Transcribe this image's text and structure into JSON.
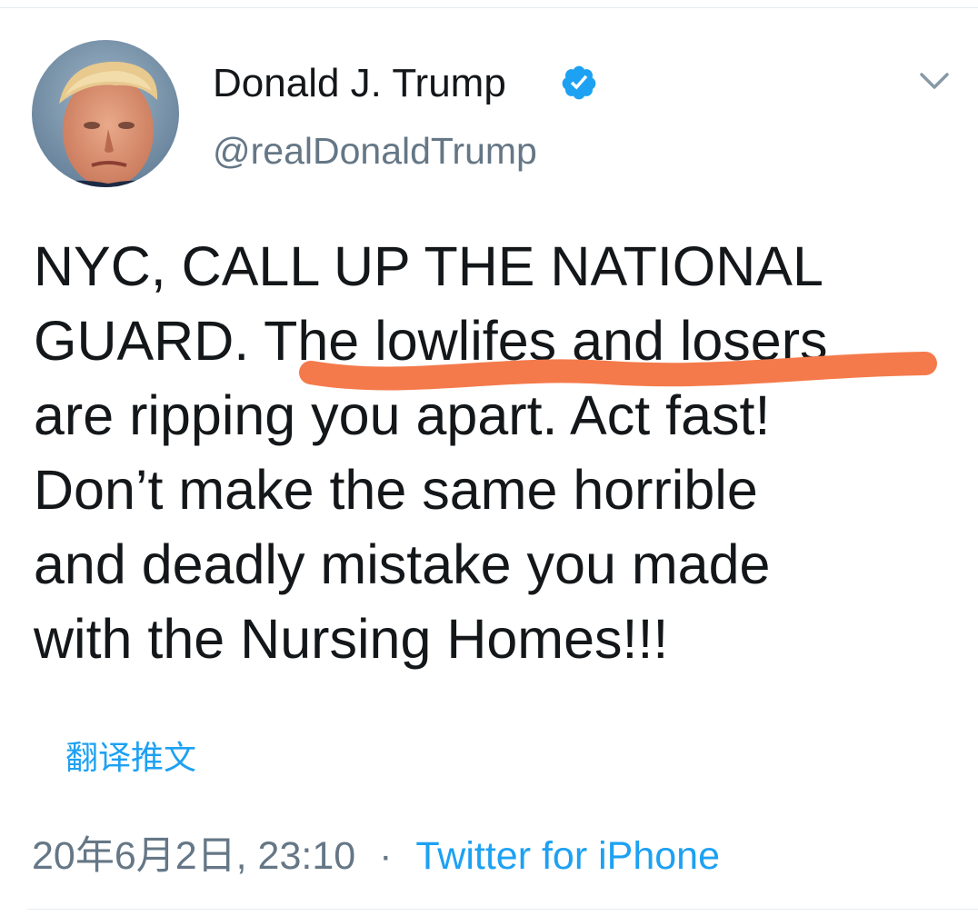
{
  "author": {
    "display_name": "Donald J. Trump",
    "handle": "@realDonaldTrump",
    "verified": true
  },
  "icons": {
    "verified": "verified-badge-icon",
    "more": "chevron-down-icon"
  },
  "tweet": {
    "text": "NYC, CALL UP THE NATIONAL\nGUARD. The lowlifes and losers\nare ripping you apart. Act fast!\nDon’t make the same horrible\nand deadly mistake you made\nwith the Nursing Homes!!!",
    "translate_label": "翻译推文"
  },
  "meta": {
    "timestamp": "20年6月2日, 23:10",
    "separator": "·",
    "source": "Twitter for iPhone"
  },
  "colors": {
    "accent": "#1da1f2",
    "annotation_stroke": "#f47a4b",
    "secondary_text": "#657786"
  }
}
